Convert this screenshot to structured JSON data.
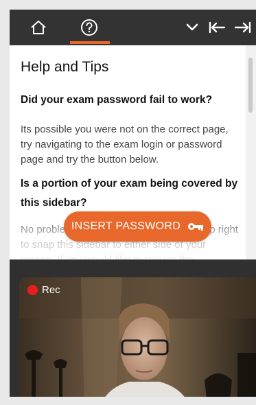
{
  "toolbar": {
    "icons": [
      "home-icon",
      "help-icon",
      "chevron-down-icon",
      "dock-left-icon",
      "dock-right-icon"
    ],
    "active_tab": "help"
  },
  "help": {
    "title": "Help and Tips",
    "q1": "Did your exam password fail to work?",
    "p1": "Its possible you were not on the correct page, try navigating to the exam login or password page and try the button below.",
    "q2": "Is a portion of your exam being covered by this sidebar?",
    "p2": "No problem, use the arrows ⇤ ⇥ in the top right to snap this sidebar to either side of your screen. If you would like to reduce the"
  },
  "insert_button": {
    "label": "INSERT PASSWORD",
    "icon": "key-icon"
  },
  "video": {
    "rec_label": "Rec"
  },
  "colors": {
    "accent": "#e8672a",
    "topbar": "#333333",
    "rec": "#e81d1d"
  }
}
